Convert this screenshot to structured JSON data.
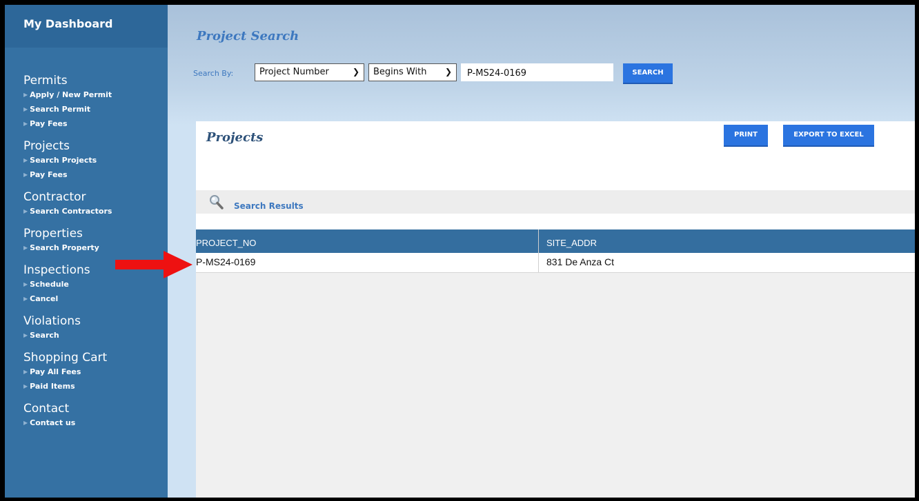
{
  "sidebar": {
    "dashboard": "My Dashboard",
    "sections": [
      {
        "title": "Permits",
        "items": [
          "Apply / New Permit",
          "Search Permit",
          "Pay Fees"
        ]
      },
      {
        "title": "Projects",
        "items": [
          "Search Projects",
          "Pay Fees"
        ]
      },
      {
        "title": "Contractor",
        "items": [
          "Search Contractors"
        ]
      },
      {
        "title": "Properties",
        "items": [
          "Search Property"
        ]
      },
      {
        "title": "Inspections",
        "items": [
          "Schedule",
          "Cancel"
        ]
      },
      {
        "title": "Violations",
        "items": [
          "Search"
        ]
      },
      {
        "title": "Shopping Cart",
        "items": [
          "Pay All Fees",
          "Paid Items"
        ]
      },
      {
        "title": "Contact",
        "items": [
          "Contact us"
        ]
      }
    ]
  },
  "search": {
    "title": "Project Search",
    "label": "Search By:",
    "field_select": "Project Number",
    "operator_select": "Begins With",
    "value": "P-MS24-0169",
    "button": "SEARCH"
  },
  "projects": {
    "title": "Projects",
    "print_button": "PRINT",
    "export_button": "EXPORT TO EXCEL",
    "results_label": "Search Results",
    "columns": [
      "PROJECT_NO",
      "SITE_ADDR"
    ],
    "rows": [
      [
        "P-MS24-0169",
        "831 De Anza Ct"
      ]
    ]
  },
  "colors": {
    "sidebar": "#3571a3",
    "accent_button": "#2b74e0",
    "table_header": "#346e9f",
    "title_blue": "#3d78bf",
    "annotation_arrow": "#ee1111"
  }
}
